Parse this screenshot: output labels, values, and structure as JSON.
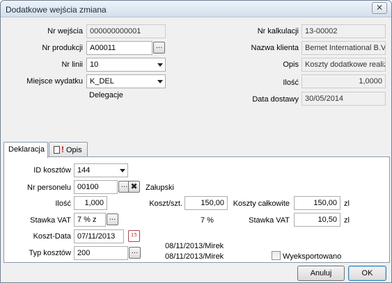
{
  "window": {
    "title": "Dodatkowe wejścia zmiana",
    "close_glyph": "✕"
  },
  "header_left": {
    "nr_wejscia": {
      "label": "Nr wejścia",
      "value": "000000000001"
    },
    "nr_produkcji": {
      "label": "Nr produkcji",
      "value": "A00011"
    },
    "nr_linii": {
      "label": "Nr linii",
      "value": "10"
    },
    "miejsce_wydatku": {
      "label": "Miejsce wydatku",
      "value": "K_DEL",
      "description": "Delegacje"
    }
  },
  "header_right": {
    "nr_kalkulacji": {
      "label": "Nr kalkulacji",
      "value": "13-00002"
    },
    "nazwa_klienta": {
      "label": "Nazwa klienta",
      "value": "Bemet International B.V."
    },
    "opis": {
      "label": "Opis",
      "value": "Koszty dodatkowe realiza"
    },
    "ilosc": {
      "label": "Ilość",
      "value": "1,0000"
    },
    "data_dostawy": {
      "label": "Data dostawy",
      "value": "30/05/2014"
    }
  },
  "tabs": [
    {
      "label": "Deklaracja",
      "active": true
    },
    {
      "label": "Opis",
      "active": false,
      "icon": "document-warning-icon",
      "prefix": "!"
    }
  ],
  "deklaracja": {
    "id_kosztow": {
      "label": "ID kosztów",
      "value": "144"
    },
    "nr_personelu": {
      "label": "Nr personelu",
      "value": "00100",
      "name": "Załupski"
    },
    "ilosc": {
      "label": "Ilość",
      "value": "1,000"
    },
    "stawka_vat_left": {
      "label": "Stawka VAT",
      "value": "7 % z"
    },
    "koszt_data": {
      "label": "Koszt-Data",
      "value": "07/11/2013",
      "calendar_glyph": "15"
    },
    "typ_kosztow": {
      "label": "Typ kosztów",
      "value": "200"
    },
    "koszt_szt": {
      "label": "Koszt/szt.",
      "value": "150,00"
    },
    "vat_percent": "7  %",
    "koszty_calkowite": {
      "label": "Koszty całkowite",
      "value": "150,00",
      "unit": "zl"
    },
    "stawka_vat_right": {
      "label": "Stawka VAT",
      "value": "10,50",
      "unit": "zl"
    },
    "stamp_1": "08/11/2013/Mirek",
    "stamp_2": "08/11/2013/Mirek",
    "wyeksportowano": {
      "label": "Wyeksportowano",
      "checked": false
    }
  },
  "buttons": {
    "cancel": "Anuluj",
    "ok": "OK",
    "ellipsis": "...",
    "clear": "✖"
  }
}
